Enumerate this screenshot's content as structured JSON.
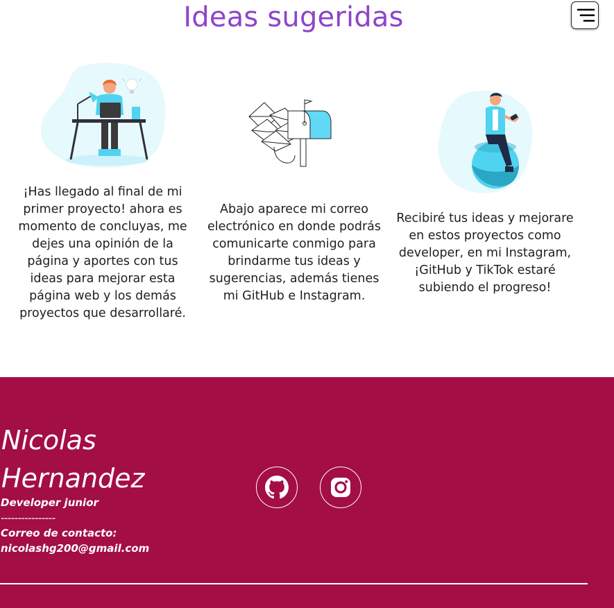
{
  "header": {
    "title": "Ideas sugeridas"
  },
  "cards": [
    {
      "illustration": "person-at-desk-illustration",
      "text": "¡Has llegado al final de mi primer proyecto! ahora es momento de concluyas, me dejes una opinión de la página y aportes con tus ideas para mejorar esta página web y los demás proyectos que desarrollaré."
    },
    {
      "illustration": "mailbox-illustration",
      "text": "Abajo aparece mi correo electrónico en donde podrás comunicarte conmigo para brindarme tus ideas y sugerencias, además tienes mi GitHub e Instagram."
    },
    {
      "illustration": "person-on-ball-illustration",
      "text": "Recibiré tus ideas y mejorare en estos proyectos como developer, en mi Instagram, ¡GitHub y TikTok estaré subiendo el progreso!"
    }
  ],
  "footer": {
    "name": "Nicolas Hernandez",
    "role": "Developer junior",
    "separator": "----------------",
    "contact_label": "Correo de contacto:",
    "email": "nicolashg200@gmail.com",
    "social": [
      "github-icon",
      "instagram-icon"
    ]
  },
  "colors": {
    "title": "#8e44c9",
    "footer_bg": "#a30e44",
    "accent_cyan": "#4fd3f0",
    "text": "#1e1e1e"
  }
}
